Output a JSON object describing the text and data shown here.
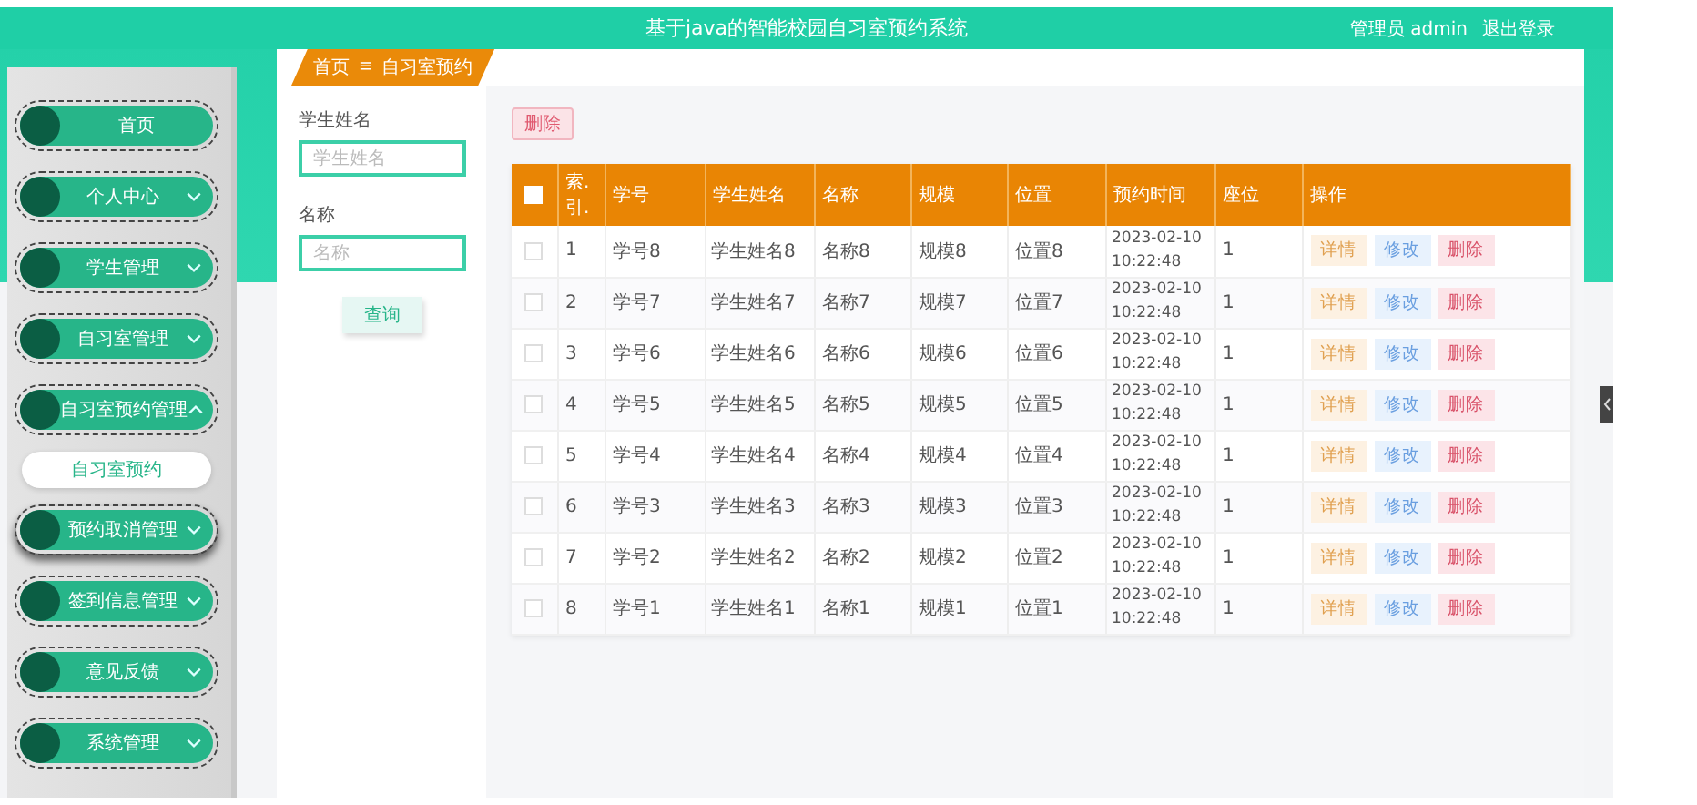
{
  "header": {
    "title": "基于java的智能校园自习室预约系统",
    "user": "管理员 admin",
    "logout": "退出登录"
  },
  "sidebar": {
    "items": [
      {
        "label": "首页",
        "kind": "link",
        "hovered": false
      },
      {
        "label": "个人中心",
        "kind": "menu",
        "expanded": false,
        "hovered": false
      },
      {
        "label": "学生管理",
        "kind": "menu",
        "expanded": false,
        "hovered": false
      },
      {
        "label": "自习室管理",
        "kind": "menu",
        "expanded": false,
        "hovered": false
      },
      {
        "label": "自习室预约管理",
        "kind": "menu",
        "expanded": true,
        "hovered": false,
        "children": [
          {
            "label": "自习室预约"
          }
        ]
      },
      {
        "label": "预约取消管理",
        "kind": "menu",
        "expanded": false,
        "hovered": true
      },
      {
        "label": "签到信息管理",
        "kind": "menu",
        "expanded": false,
        "hovered": false
      },
      {
        "label": "意见反馈",
        "kind": "menu",
        "expanded": false,
        "hovered": false
      },
      {
        "label": "系统管理",
        "kind": "menu",
        "expanded": false,
        "hovered": false
      }
    ]
  },
  "breadcrumb": {
    "items": [
      "首页",
      "自习室预约"
    ],
    "separator": "≡"
  },
  "search": {
    "fields": [
      {
        "label": "学生姓名",
        "placeholder": "学生姓名"
      },
      {
        "label": "名称",
        "placeholder": "名称"
      }
    ],
    "button": "查询"
  },
  "toolbar": {
    "delete_button": "删除"
  },
  "table": {
    "select_all_checked": false,
    "columns": [
      "索.引.",
      "学号",
      "学生姓名",
      "名称",
      "规模",
      "位置",
      "预约时间",
      "座位",
      "操作"
    ],
    "rows": [
      {
        "checked": false,
        "cells": [
          "1",
          "学号8",
          "学生姓名8",
          "名称8",
          "规模8",
          "位置8",
          "2023-02-10 10:22:48",
          "1"
        ],
        "actions": [
          {
            "kind": "detail",
            "label": "详情"
          },
          {
            "kind": "edit",
            "label": "修改"
          },
          {
            "kind": "delete",
            "label": "删除"
          }
        ]
      },
      {
        "checked": false,
        "cells": [
          "2",
          "学号7",
          "学生姓名7",
          "名称7",
          "规模7",
          "位置7",
          "2023-02-10 10:22:48",
          "1"
        ],
        "actions": [
          {
            "kind": "detail",
            "label": "详情"
          },
          {
            "kind": "edit",
            "label": "修改"
          },
          {
            "kind": "delete",
            "label": "删除"
          }
        ]
      },
      {
        "checked": false,
        "cells": [
          "3",
          "学号6",
          "学生姓名6",
          "名称6",
          "规模6",
          "位置6",
          "2023-02-10 10:22:48",
          "1"
        ],
        "actions": [
          {
            "kind": "detail",
            "label": "详情"
          },
          {
            "kind": "edit",
            "label": "修改"
          },
          {
            "kind": "delete",
            "label": "删除"
          }
        ]
      },
      {
        "checked": false,
        "cells": [
          "4",
          "学号5",
          "学生姓名5",
          "名称5",
          "规模5",
          "位置5",
          "2023-02-10 10:22:48",
          "1"
        ],
        "actions": [
          {
            "kind": "detail",
            "label": "详情"
          },
          {
            "kind": "edit",
            "label": "修改"
          },
          {
            "kind": "delete",
            "label": "删除"
          }
        ]
      },
      {
        "checked": false,
        "cells": [
          "5",
          "学号4",
          "学生姓名4",
          "名称4",
          "规模4",
          "位置4",
          "2023-02-10 10:22:48",
          "1"
        ],
        "actions": [
          {
            "kind": "detail",
            "label": "详情"
          },
          {
            "kind": "edit",
            "label": "修改"
          },
          {
            "kind": "delete",
            "label": "删除"
          }
        ]
      },
      {
        "checked": false,
        "cells": [
          "6",
          "学号3",
          "学生姓名3",
          "名称3",
          "规模3",
          "位置3",
          "2023-02-10 10:22:48",
          "1"
        ],
        "actions": [
          {
            "kind": "detail",
            "label": "详情"
          },
          {
            "kind": "edit",
            "label": "修改"
          },
          {
            "kind": "delete",
            "label": "删除"
          }
        ]
      },
      {
        "checked": false,
        "cells": [
          "7",
          "学号2",
          "学生姓名2",
          "名称2",
          "规模2",
          "位置2",
          "2023-02-10 10:22:48",
          "1"
        ],
        "actions": [
          {
            "kind": "detail",
            "label": "详情"
          },
          {
            "kind": "edit",
            "label": "修改"
          },
          {
            "kind": "delete",
            "label": "删除"
          }
        ]
      },
      {
        "checked": false,
        "cells": [
          "8",
          "学号1",
          "学生姓名1",
          "名称1",
          "规模1",
          "位置1",
          "2023-02-10 10:22:48",
          "1"
        ],
        "actions": [
          {
            "kind": "detail",
            "label": "详情"
          },
          {
            "kind": "edit",
            "label": "修改"
          },
          {
            "kind": "delete",
            "label": "删除"
          }
        ]
      }
    ]
  }
}
